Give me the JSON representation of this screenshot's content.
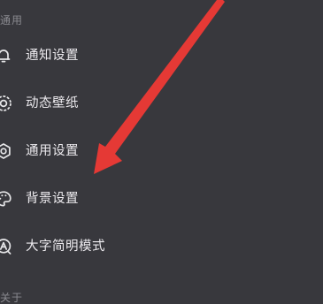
{
  "sections": {
    "general": {
      "header": "通用"
    },
    "about": {
      "header": "关于"
    }
  },
  "menu": {
    "items": [
      {
        "label": "通知设置",
        "icon": "bell-icon"
      },
      {
        "label": "动态壁纸",
        "icon": "live-wallpaper-icon"
      },
      {
        "label": "通用设置",
        "icon": "gear-icon"
      },
      {
        "label": "背景设置",
        "icon": "palette-icon"
      },
      {
        "label": "大字简明模式",
        "icon": "large-text-icon"
      }
    ]
  },
  "annotation": {
    "arrow_color": "#e53935",
    "points_to": "背景设置"
  },
  "colors": {
    "background": "#38383d",
    "text": "#eceaee",
    "section_header": "#8a8a90"
  }
}
